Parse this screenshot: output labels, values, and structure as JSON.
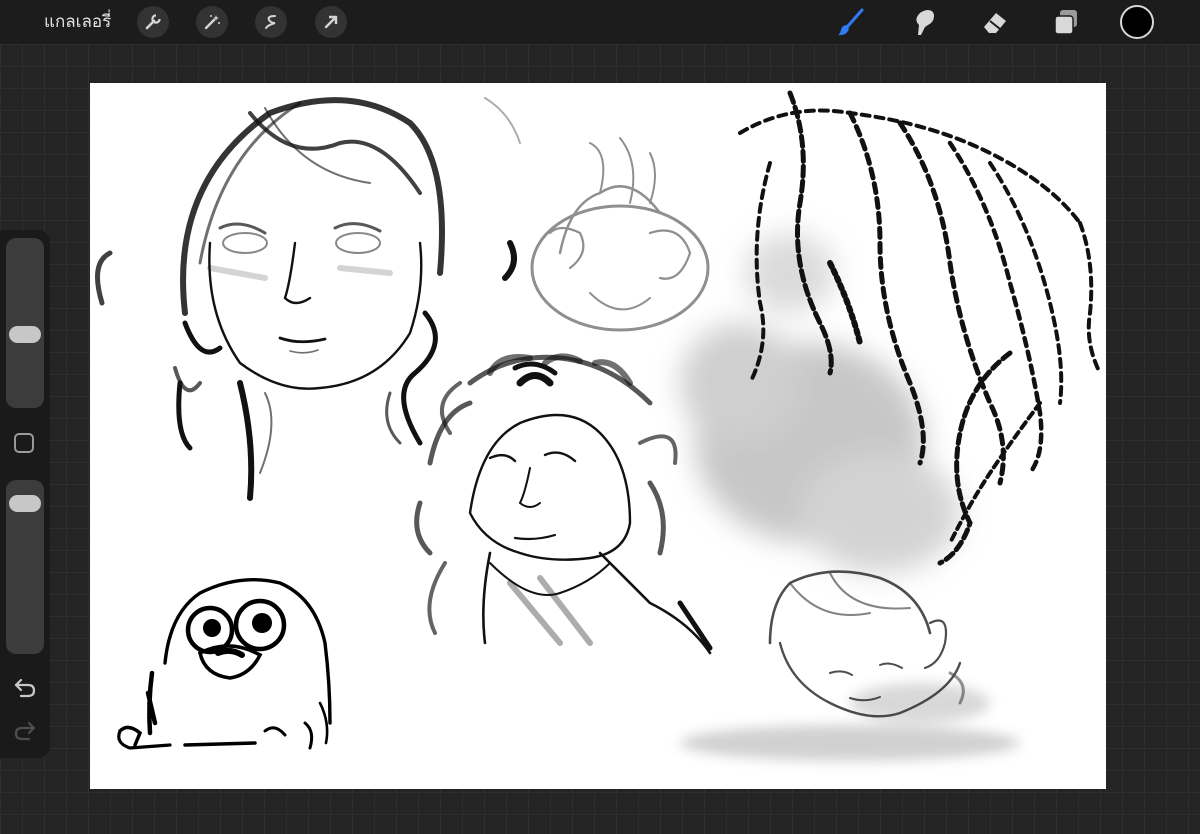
{
  "topbar": {
    "gallery_label": "แกลเลอรี่",
    "left_tools": [
      "wrench-icon",
      "magic-wand-icon",
      "selection-icon",
      "transform-arrow-icon"
    ],
    "right_tools": [
      "brush-icon",
      "smudge-icon",
      "eraser-icon",
      "layers-icon"
    ],
    "active_tool": "brush",
    "accent_color": "#2f7bf6",
    "current_color": "#000000"
  },
  "sidebar": {
    "brush_size_level": 0.42,
    "opacity_level": 0.94,
    "buttons": [
      "modify-button",
      "undo-icon",
      "redo-icon"
    ]
  },
  "canvas": {
    "background": "#ffffff",
    "content": "sketch-drawings"
  }
}
